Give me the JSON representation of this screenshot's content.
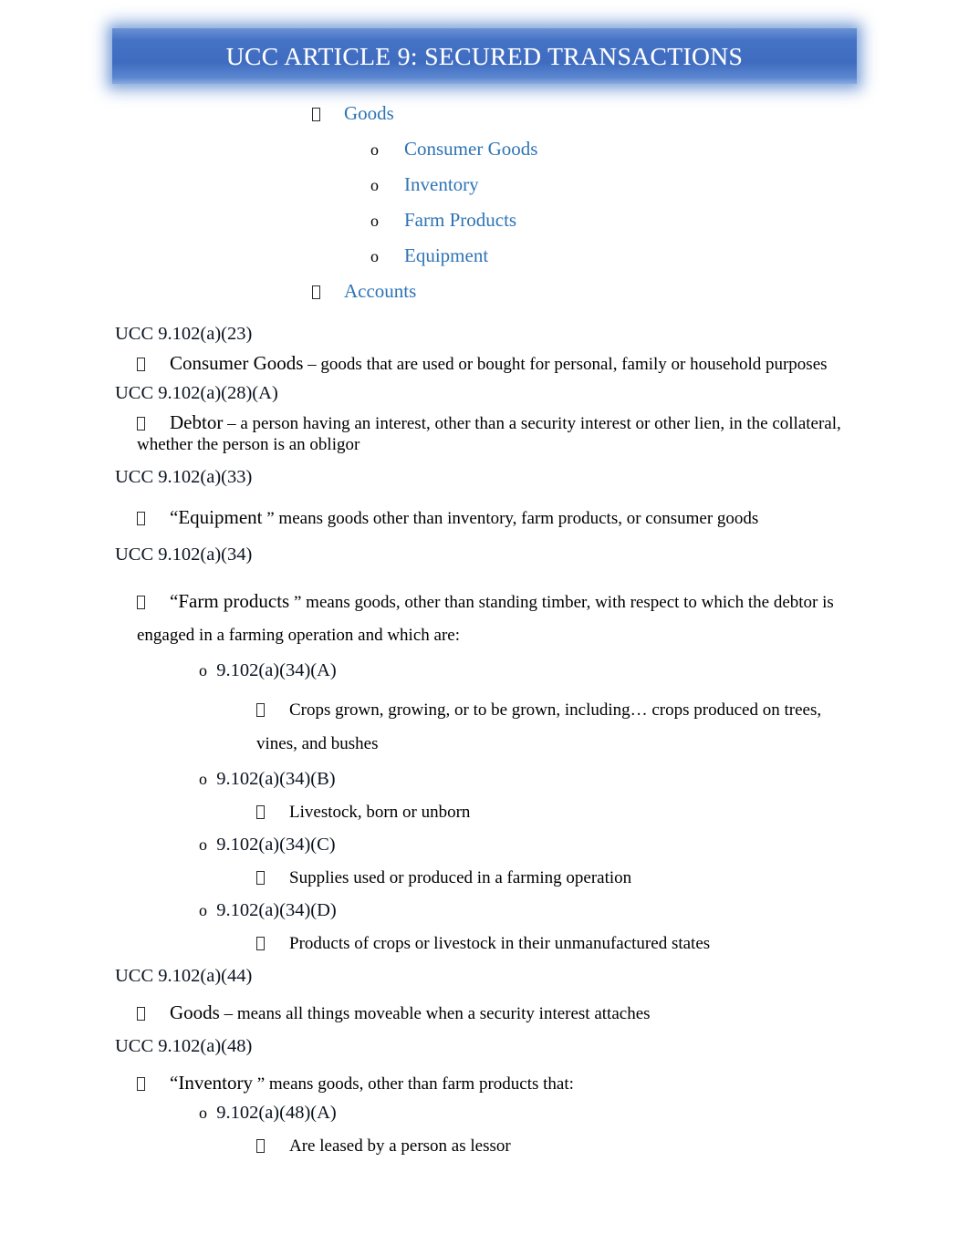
{
  "document": {
    "title": "UCC ARTICLE 9: SECURED TRANSACTIONS",
    "colors": {
      "banner_blue": "#4472C4",
      "link_blue": "#2E74B5",
      "highlight_cyan": "#00FFFF",
      "body_text": "#000000"
    }
  },
  "outline": {
    "items": [
      {
        "level": 1,
        "bullet": "tofu-box",
        "label": "Goods"
      },
      {
        "level": 2,
        "bullet": "o",
        "label": "Consumer Goods"
      },
      {
        "level": 2,
        "bullet": "o",
        "label": "Inventory"
      },
      {
        "level": 2,
        "bullet": "o",
        "label": "Farm Products"
      },
      {
        "level": 2,
        "bullet": "o",
        "label": "Equipment"
      },
      {
        "level": 1,
        "bullet": "tofu-box",
        "label": "Accounts"
      }
    ]
  },
  "sections": [
    {
      "citation": "UCC 9.102(a)(23)",
      "term": "Consumer Goods",
      "definition": " – goods that are used or bought for personal, family or household purposes"
    },
    {
      "citation": "UCC 9.102(a)(28)(A)",
      "term": "Debtor",
      "definition": " – a person having an interest, other than a security interest or other lien, in the collateral, whether the person is an obligor"
    },
    {
      "citation": "UCC 9.102(a)(33)",
      "term": "“Equipment",
      "definition": " ” means goods other than inventory, farm products, or consumer goods"
    },
    {
      "citation": "UCC 9.102(a)(34)",
      "term": "“Farm products",
      "definition": " ” means goods, other than standing timber, with respect to which the debtor is engaged in a farming operation and which are:",
      "subitems": [
        {
          "citation": "9.102(a)(34)(A)",
          "text": "Crops grown, growing, or to be grown, including… crops produced on trees, vines, and bushes"
        },
        {
          "citation": "9.102(a)(34)(B)",
          "text": "Livestock, born or unborn"
        },
        {
          "citation": "9.102(a)(34)(C)",
          "text": "Supplies used or produced in a farming operation"
        },
        {
          "citation": "9.102(a)(34)(D)",
          "text": "Products of crops or livestock in their unmanufactured states"
        }
      ]
    },
    {
      "citation": "UCC 9.102(a)(44)",
      "term": "Goods",
      "definition": " – means all things moveable when a security interest attaches"
    },
    {
      "citation": "UCC 9.102(a)(48)",
      "term": "“Inventory",
      "definition": " ” means goods, other than farm products that:",
      "subitems": [
        {
          "citation": "9.102(a)(48)(A)",
          "text": "Are leased by a person as lessor"
        }
      ]
    }
  ],
  "markers": {
    "sub_bullet_letter": "o"
  }
}
